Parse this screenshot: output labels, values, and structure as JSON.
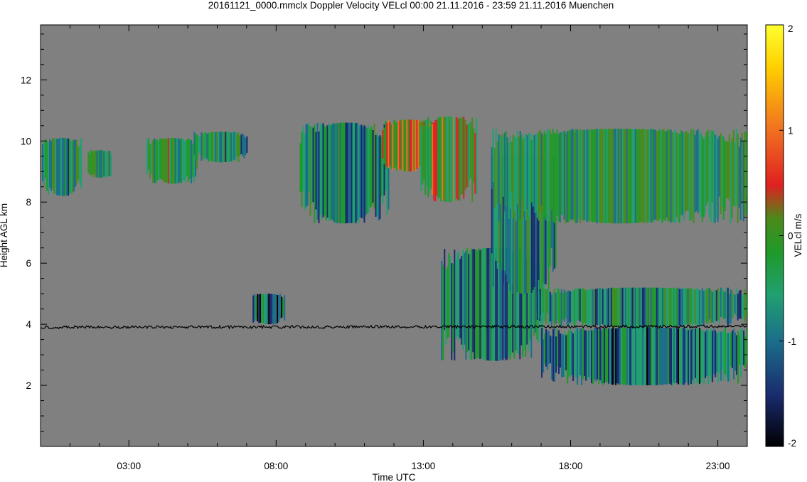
{
  "chart_data": {
    "type": "heatmap",
    "title": "20161121_0000.mmclx Doppler Velocity VELcl   00:00 21.11.2016 - 23:59 21.11.2016 Muenchen",
    "xlabel": "Time UTC",
    "ylabel": "Height AGL km",
    "colorbar_label": "VELcl m/s",
    "xlim": [
      0,
      24
    ],
    "ylim": [
      0,
      13.8
    ],
    "zlim": [
      -2,
      2
    ],
    "x_tick_values": [
      3,
      8,
      13,
      18,
      23
    ],
    "x_tick_labels": [
      "03:00",
      "08:00",
      "13:00",
      "18:00",
      "23:00"
    ],
    "y_tick_values": [
      2,
      4,
      6,
      8,
      10,
      12
    ],
    "y_tick_labels": [
      "2",
      "4",
      "6",
      "8",
      "10",
      "12"
    ],
    "colorbar_tick_values": [
      2,
      1,
      0,
      -1,
      -2
    ],
    "colorbar_tick_labels": [
      "2",
      "1",
      "0",
      "-1",
      "-2"
    ],
    "colormap": [
      "#000000",
      "#1a2a6e",
      "#1b6e8a",
      "#20a070",
      "#1e9a2a",
      "#4a8a1a",
      "#e02020",
      "#f07020",
      "#ffd000",
      "#ffff30"
    ],
    "background_color": "#808080",
    "line_series": {
      "name": "",
      "color": "#000000",
      "x": [
        0,
        24
      ],
      "y": [
        3.9,
        3.93
      ]
    },
    "echo_regions": [
      {
        "t0": 0.05,
        "t1": 1.4,
        "h0": 8.2,
        "h1": 10.1,
        "mean_velocity": -0.5
      },
      {
        "t0": 1.6,
        "t1": 2.4,
        "h0": 8.8,
        "h1": 9.7,
        "mean_velocity": -0.4
      },
      {
        "t0": 3.6,
        "t1": 5.3,
        "h0": 8.6,
        "h1": 10.1,
        "mean_velocity": -0.3
      },
      {
        "t0": 5.2,
        "t1": 7.0,
        "h0": 9.3,
        "h1": 10.3,
        "mean_velocity": -0.5
      },
      {
        "t0": 7.2,
        "t1": 8.3,
        "h0": 4.0,
        "h1": 5.0,
        "mean_velocity": -1.0
      },
      {
        "t0": 8.8,
        "t1": 11.8,
        "h0": 7.3,
        "h1": 10.6,
        "mean_velocity": -0.7
      },
      {
        "t0": 11.6,
        "t1": 13.3,
        "h0": 9.0,
        "h1": 10.7,
        "mean_velocity": 0.4
      },
      {
        "t0": 12.9,
        "t1": 14.8,
        "h0": 8.0,
        "h1": 10.8,
        "mean_velocity": 0.1
      },
      {
        "t0": 13.6,
        "t1": 17.1,
        "h0": 2.8,
        "h1": 6.5,
        "mean_velocity": -0.8
      },
      {
        "t0": 15.3,
        "t1": 17.5,
        "h0": 5.0,
        "h1": 9.6,
        "mean_velocity": -0.6
      },
      {
        "t0": 15.3,
        "t1": 24.0,
        "h0": 7.3,
        "h1": 10.4,
        "mean_velocity": -0.4
      },
      {
        "t0": 16.8,
        "t1": 24.0,
        "h0": 3.9,
        "h1": 5.2,
        "mean_velocity": -0.6
      },
      {
        "t0": 17.0,
        "t1": 24.0,
        "h0": 2.0,
        "h1": 3.9,
        "mean_velocity": -0.9
      }
    ]
  }
}
